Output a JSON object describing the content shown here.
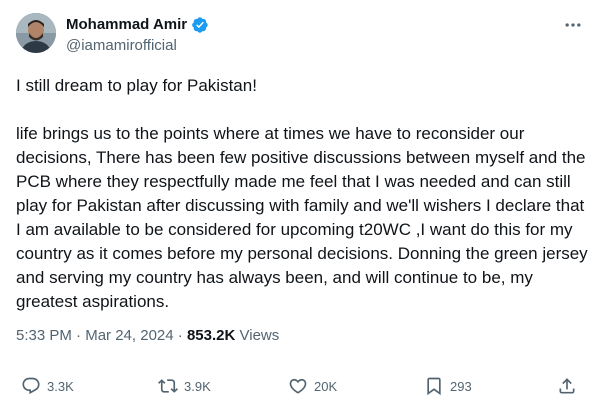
{
  "author": {
    "display_name": "Mohammad Amir",
    "handle": "@iamamirofficial",
    "verified": true
  },
  "tweet": {
    "text": "I still dream to play for Pakistan!\n\nlife brings us to the points where at times we have to reconsider our decisions, There has been few positive discussions between myself and the PCB where they respectfully made me feel that I was needed and can still play for Pakistan after discussing with family and we'll wishers I declare that I am available to be considered for upcoming t20WC ,I want do this for my country as it comes before my personal decisions. Donning the green jersey and serving my country has always been, and will continue to be, my greatest aspirations.",
    "time": "5:33 PM",
    "separator": "·",
    "date": "Mar 24, 2024",
    "views_count": "853.2K",
    "views_label": "Views"
  },
  "actions": {
    "replies": "3.3K",
    "retweets": "3.9K",
    "likes": "20K",
    "bookmarks": "293"
  },
  "icons": {
    "more": "more-dots-icon",
    "verified": "verified-badge-icon",
    "reply": "reply-icon",
    "retweet": "retweet-icon",
    "like": "heart-icon",
    "bookmark": "bookmark-icon",
    "share": "share-icon"
  },
  "colors": {
    "text": "#0f1419",
    "secondary": "#536471",
    "verified_blue": "#1d9bf0"
  }
}
